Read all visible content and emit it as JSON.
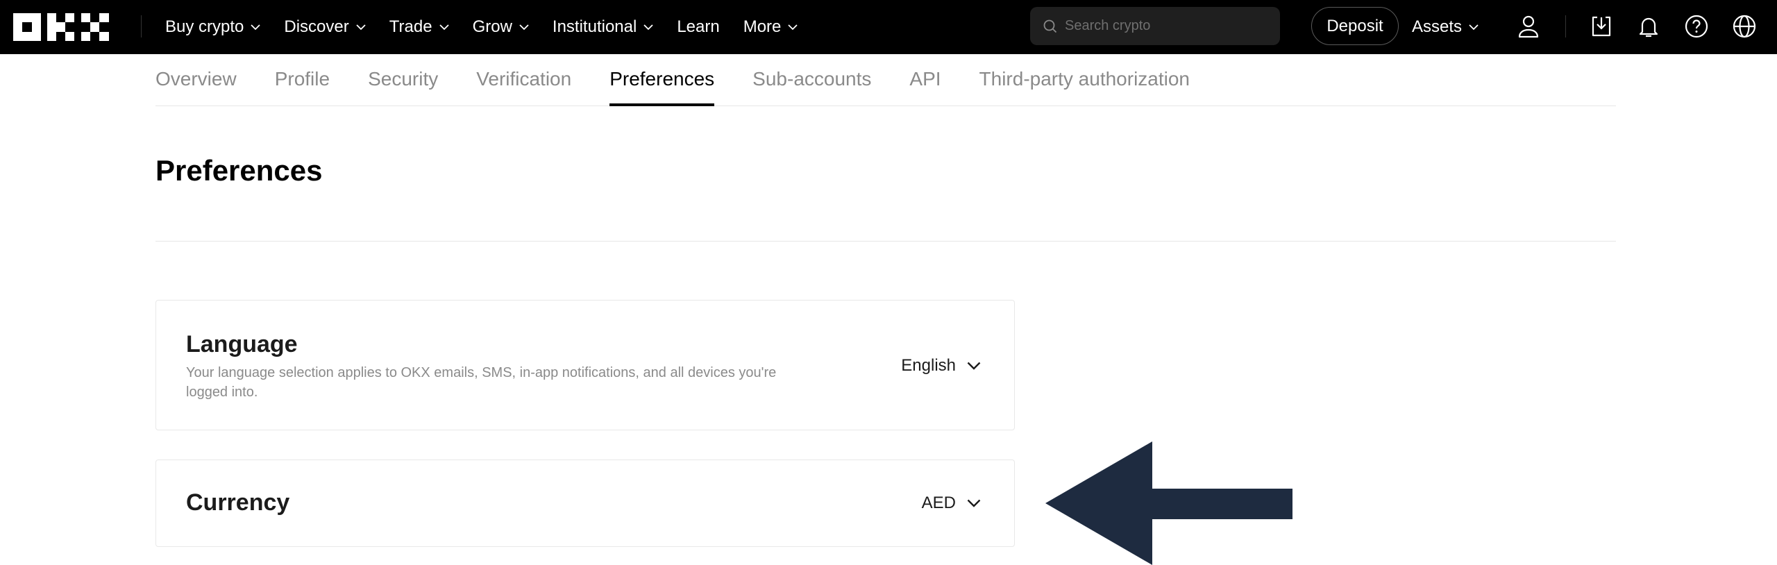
{
  "brand": {
    "name": "OKX"
  },
  "topnav": {
    "items": [
      {
        "label": "Buy crypto",
        "dropdown": true
      },
      {
        "label": "Discover",
        "dropdown": true
      },
      {
        "label": "Trade",
        "dropdown": true
      },
      {
        "label": "Grow",
        "dropdown": true
      },
      {
        "label": "Institutional",
        "dropdown": true
      },
      {
        "label": "Learn",
        "dropdown": false
      },
      {
        "label": "More",
        "dropdown": true
      }
    ],
    "search_placeholder": "Search crypto",
    "deposit_label": "Deposit",
    "assets_label": "Assets",
    "icons": [
      "user-icon",
      "download-icon",
      "bell-icon",
      "help-icon",
      "globe-icon"
    ]
  },
  "tabs": [
    {
      "label": "Overview",
      "active": false
    },
    {
      "label": "Profile",
      "active": false
    },
    {
      "label": "Security",
      "active": false
    },
    {
      "label": "Verification",
      "active": false
    },
    {
      "label": "Preferences",
      "active": true
    },
    {
      "label": "Sub-accounts",
      "active": false
    },
    {
      "label": "API",
      "active": false
    },
    {
      "label": "Third-party authorization",
      "active": false
    }
  ],
  "page": {
    "title": "Preferences"
  },
  "language": {
    "title": "Language",
    "description": "Your language selection applies to OKX emails, SMS, in-app notifications, and all devices you're logged into.",
    "value": "English"
  },
  "currency": {
    "title": "Currency",
    "value": "AED"
  },
  "colors": {
    "topbar": "#000000",
    "arrow": "#1e2b40",
    "muted_text": "#8a8a8a"
  }
}
